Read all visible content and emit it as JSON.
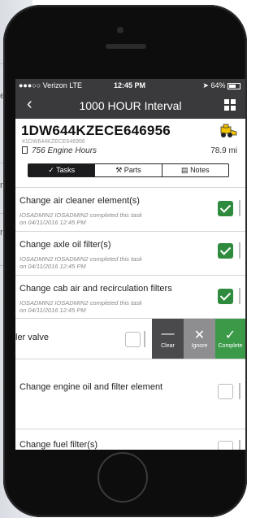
{
  "status": {
    "carrier": "●●●○○ Verizon  LTE",
    "time": "12:45 PM",
    "battery": "64%"
  },
  "nav": {
    "back": "‹",
    "title": "1000 HOUR Interval"
  },
  "equipment": {
    "vin": "1DW644KZECE646956",
    "vin_sub": "#1DW644KZECE646956",
    "hours": "756",
    "hours_label": "Engine Hours",
    "distance": "78.9 mi"
  },
  "tabs": [
    "Tasks",
    "Parts",
    "Notes"
  ],
  "tasks": [
    {
      "name": "Change air cleaner element(s)",
      "meta1": "IOSADMIN2 IOSADMIN2 completed this task",
      "meta2": "on 04/11/2016 12:45 PM"
    },
    {
      "name": "Change axle oil filter(s)",
      "meta1": "IOSADMIN2 IOSADMIN2 completed this task",
      "meta2": "on 04/11/2016 12:45 PM"
    },
    {
      "name": "Change cab air and recirculation filters",
      "meta1": "IOSADMIN2 IOSADMIN2 completed this task",
      "meta2": "on 04/11/2016 12:45 PM"
    },
    {
      "name": "ler valve"
    },
    {
      "name": "Change engine oil and filter element"
    },
    {
      "name": "Change fuel filter(s)"
    }
  ],
  "swipe_actions": {
    "clear": "Clear",
    "ignore": "Ignore",
    "complete": "Complete"
  },
  "colors": {
    "nav": "#3a3a3c",
    "check_green": "#2e8b3e",
    "complete_green": "#3a9a48"
  }
}
